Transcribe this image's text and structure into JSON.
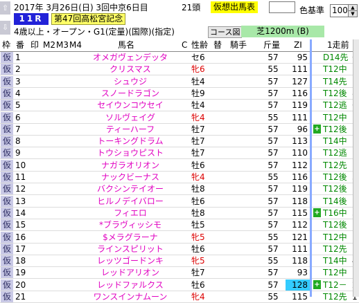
{
  "header": {
    "nav_up": "⇧",
    "nav_down": "⇩",
    "date_text": "2017年  3月26日(日)   3回中京6日目",
    "runners": "21頭",
    "badge": "仮想出馬表",
    "race_number": "11R",
    "race_name": "第47回高松宮記念",
    "race_conditions": "4歳以上・オープン・G1(定量)(国際)(指定)",
    "course_button": "コース図",
    "track": "芝1200m (B)",
    "color_label": "色基準",
    "color_value": "100"
  },
  "columns": {
    "waku": "枠",
    "num": "番",
    "mark": "印",
    "m2": "M2",
    "m3": "M3",
    "m4": "M4",
    "name": "馬名",
    "c": "C",
    "sex_age": "性齢",
    "change": "替",
    "jockey": "騎手",
    "weight": "斤量",
    "zi": "ZI",
    "prev_run": "1走前"
  },
  "rows": [
    {
      "waku": "仮",
      "num": "1",
      "name": "オメガヴェンデッタ",
      "sex": "セ6",
      "sex_color": "#000000",
      "weight": "57",
      "zi": "95",
      "hl": false,
      "mark": "",
      "prev": "D14先",
      "prev_extra": "6"
    },
    {
      "waku": "仮",
      "num": "2",
      "name": "クリスマス",
      "sex": "牝6",
      "sex_color": "#dd0000",
      "weight": "55",
      "zi": "111",
      "hl": false,
      "mark": "",
      "prev": "T12中",
      "prev_extra": "1"
    },
    {
      "waku": "仮",
      "num": "3",
      "name": "シュウジ",
      "sex": "牡4",
      "sex_color": "#000000",
      "weight": "57",
      "zi": "127",
      "hl": false,
      "mark": "",
      "prev": "T14先",
      "prev_extra": "1"
    },
    {
      "waku": "仮",
      "num": "4",
      "name": "スノードラゴン",
      "sex": "牡9",
      "sex_color": "#000000",
      "weight": "57",
      "zi": "116",
      "hl": false,
      "mark": "",
      "prev": "T12後",
      "prev_extra": "8"
    },
    {
      "waku": "仮",
      "num": "5",
      "name": "セイウンコウセイ",
      "sex": "牡4",
      "sex_color": "#000000",
      "weight": "57",
      "zi": "119",
      "hl": false,
      "mark": "",
      "prev": "T12逃",
      "prev_extra": "6"
    },
    {
      "waku": "仮",
      "num": "6",
      "name": "ソルヴェイグ",
      "sex": "牝4",
      "sex_color": "#dd0000",
      "weight": "55",
      "zi": "111",
      "hl": false,
      "mark": "",
      "prev": "T12中",
      "prev_extra": "1"
    },
    {
      "waku": "仮",
      "num": "7",
      "name": "ティーハーフ",
      "sex": "牡7",
      "sex_color": "#000000",
      "weight": "57",
      "zi": "96",
      "hl": false,
      "mark": "+",
      "prev": "T12後",
      "prev_extra": "1"
    },
    {
      "waku": "仮",
      "num": "8",
      "name": "トーキングドラム",
      "sex": "牡7",
      "sex_color": "#000000",
      "weight": "57",
      "zi": "113",
      "hl": false,
      "mark": "",
      "prev": "T14中",
      "prev_extra": "1"
    },
    {
      "waku": "仮",
      "num": "9",
      "name": "トウショウピスト",
      "sex": "牡7",
      "sex_color": "#000000",
      "weight": "57",
      "zi": "110",
      "hl": false,
      "mark": "",
      "prev": "T12逃",
      "prev_extra": "1"
    },
    {
      "waku": "仮",
      "num": "10",
      "name": "ナガラオリオン",
      "sex": "牡6",
      "sex_color": "#000000",
      "weight": "57",
      "zi": "112",
      "hl": false,
      "mark": "",
      "prev": "T12先",
      "prev_extra": "1"
    },
    {
      "waku": "仮",
      "num": "11",
      "name": "ナックビーナス",
      "sex": "牝4",
      "sex_color": "#dd0000",
      "weight": "55",
      "zi": "116",
      "hl": false,
      "mark": "",
      "prev": "T12後",
      "prev_extra": "3"
    },
    {
      "waku": "仮",
      "num": "12",
      "name": "バクシンテイオー",
      "sex": "牡8",
      "sex_color": "#000000",
      "weight": "57",
      "zi": "119",
      "hl": false,
      "mark": "",
      "prev": "T12後",
      "prev_extra": "1"
    },
    {
      "waku": "仮",
      "num": "13",
      "name": "ヒルノデイバロー",
      "sex": "牡6",
      "sex_color": "#000000",
      "weight": "57",
      "zi": "118",
      "hl": false,
      "mark": "",
      "prev": "T14後",
      "prev_extra": "1"
    },
    {
      "waku": "仮",
      "num": "14",
      "name": "フィエロ",
      "sex": "牡8",
      "sex_color": "#000000",
      "weight": "57",
      "zi": "115",
      "hl": false,
      "mark": "+",
      "prev": "T16中",
      "prev_extra": "3"
    },
    {
      "waku": "仮",
      "num": "15",
      "name": "*ブラヴィッシモ",
      "sex": "牡5",
      "sex_color": "#000000",
      "weight": "57",
      "zi": "112",
      "hl": false,
      "mark": "",
      "prev": "T12後",
      "prev_extra": "1"
    },
    {
      "waku": "仮",
      "num": "16",
      "name": "$メラグラーナ",
      "sex": "牝5",
      "sex_color": "#dd0000",
      "weight": "55",
      "zi": "121",
      "hl": false,
      "mark": "",
      "prev": "T12中",
      "prev_extra": "1"
    },
    {
      "waku": "仮",
      "num": "17",
      "name": "ラインスピリット",
      "sex": "牡6",
      "sex_color": "#000000",
      "weight": "57",
      "zi": "111",
      "hl": false,
      "mark": "",
      "prev": "T12先",
      "prev_extra": "1"
    },
    {
      "waku": "仮",
      "num": "18",
      "name": "レッツゴードンキ",
      "sex": "牝5",
      "sex_color": "#dd0000",
      "weight": "55",
      "zi": "118",
      "hl": false,
      "mark": "",
      "prev": "T14中",
      "prev_extra": "4"
    },
    {
      "waku": "仮",
      "num": "19",
      "name": "レッドアリオン",
      "sex": "牡7",
      "sex_color": "#000000",
      "weight": "57",
      "zi": "93",
      "hl": false,
      "mark": "",
      "prev": "T12中",
      "prev_extra": "1"
    },
    {
      "waku": "仮",
      "num": "20",
      "name": "レッドファルクス",
      "sex": "牡6",
      "sex_color": "#000000",
      "weight": "57",
      "zi": "128",
      "hl": true,
      "mark": "+",
      "prev": "T12－",
      "prev_extra": "2"
    },
    {
      "waku": "仮",
      "num": "21",
      "name": "ワンスインナムーン",
      "sex": "牝4",
      "sex_color": "#dd0000",
      "weight": "55",
      "zi": "115",
      "hl": false,
      "mark": "",
      "prev": "T12先",
      "prev_extra": "1"
    }
  ]
}
